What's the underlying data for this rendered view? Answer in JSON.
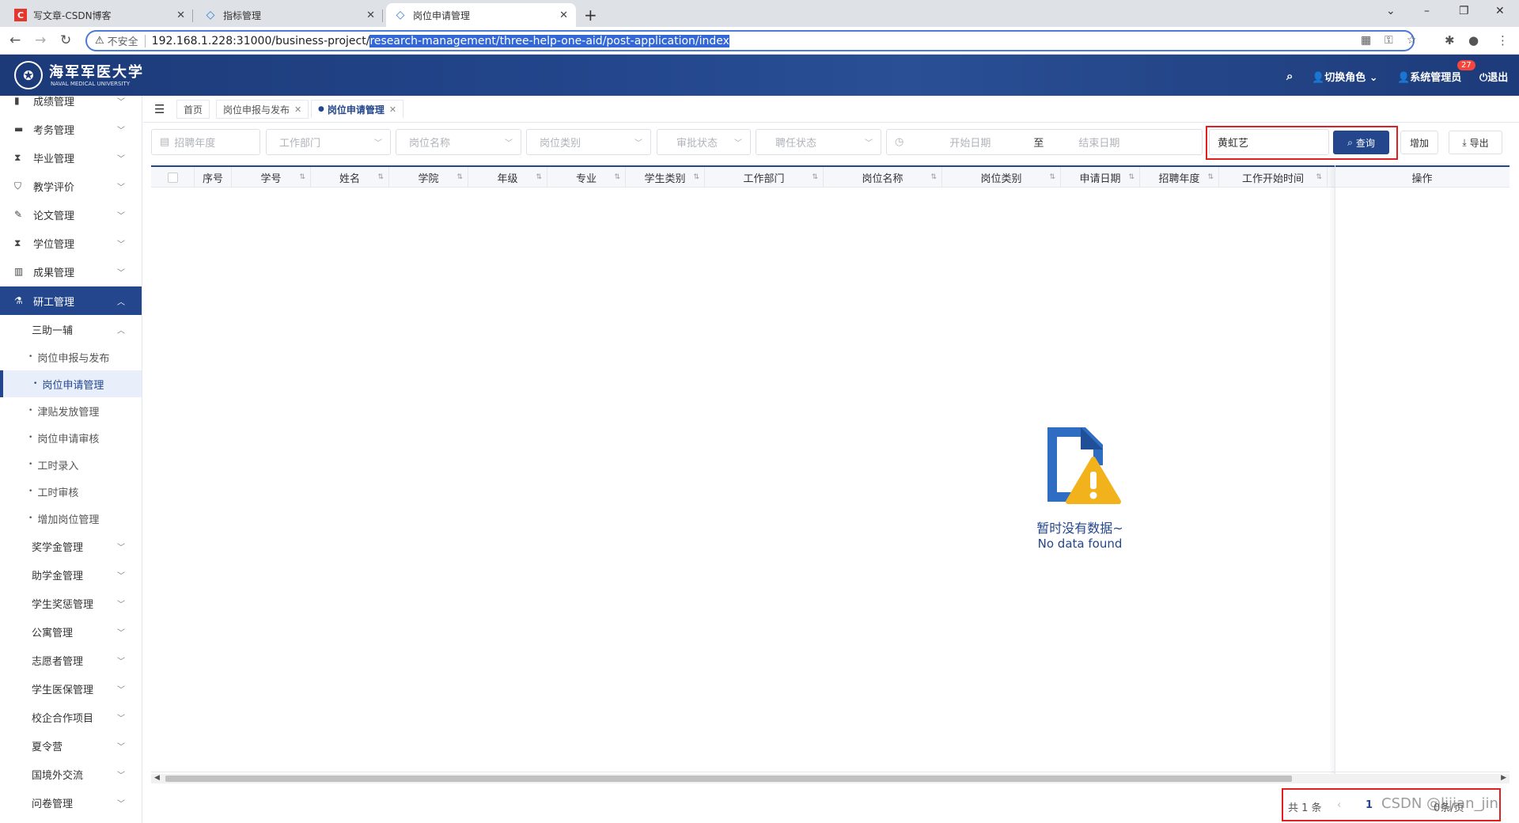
{
  "browser": {
    "tabs": [
      {
        "title": "写文章-CSDN博客",
        "icon": "csdn-icon"
      },
      {
        "title": "指标管理",
        "icon": "diamond-icon"
      },
      {
        "title": "岗位申请管理",
        "icon": "diamond-icon"
      }
    ],
    "address": {
      "security": "不安全",
      "host": "192.168.1.228:31000/business-project/",
      "path": "research-management/three-help-one-aid/post-application/index"
    }
  },
  "header": {
    "logo_text": "海军军医大学",
    "logo_sub": "NAVAL MEDICAL UNIVERSITY",
    "switch_role": "切换角色",
    "user": "系统管理员",
    "badge": "27",
    "logout": "退出"
  },
  "sidebar": {
    "top_items": [
      {
        "label": "成绩管理",
        "icon": "book-icon"
      },
      {
        "label": "考务管理",
        "icon": "briefcase-icon"
      },
      {
        "label": "毕业管理",
        "icon": "graduation-icon"
      },
      {
        "label": "教学评价",
        "icon": "shield-icon"
      },
      {
        "label": "论文管理",
        "icon": "edit-icon"
      },
      {
        "label": "学位管理",
        "icon": "graduation-icon"
      },
      {
        "label": "成果管理",
        "icon": "bar-chart-icon"
      },
      {
        "label": "研工管理",
        "icon": "flask-icon"
      }
    ],
    "group": "三助一辅",
    "sub_items": [
      "岗位申报与发布",
      "岗位申请管理",
      "津贴发放管理",
      "岗位申请审核",
      "工时录入",
      "工时审核",
      "增加岗位管理"
    ],
    "bottom_items": [
      "奖学金管理",
      "助学金管理",
      "学生奖惩管理",
      "公寓管理",
      "志愿者管理",
      "学生医保管理",
      "校企合作项目",
      "夏令营",
      "国境外交流",
      "问卷管理"
    ]
  },
  "page_tabs": {
    "home": "首页",
    "tab1": "岗位申报与发布",
    "tab2": "岗位申请管理"
  },
  "filters": {
    "year": "招聘年度",
    "dept": "工作部门",
    "post_name": "岗位名称",
    "post_type": "岗位类别",
    "audit": "审批状态",
    "hire": "聘任状态",
    "start": "开始日期",
    "to": "至",
    "end": "结束日期",
    "keyword": "黄虹艺"
  },
  "buttons": {
    "query": "查询",
    "add": "增加",
    "export": "导出"
  },
  "table": {
    "columns": [
      "序号",
      "学号",
      "姓名",
      "学院",
      "年级",
      "专业",
      "学生类别",
      "工作部门",
      "岗位名称",
      "岗位类别",
      "申请日期",
      "招聘年度",
      "工作开始时间"
    ],
    "op": "操作",
    "empty_cn": "暂时没有数据~",
    "empty_en": "No data found"
  },
  "pager": {
    "total": "共 1 条",
    "page": "1",
    "size": "0条/页"
  },
  "watermark": "CSDN @lijian_jin",
  "colors": {
    "primary": "#23468c",
    "danger": "#e02020",
    "warning": "#f2b21c"
  }
}
